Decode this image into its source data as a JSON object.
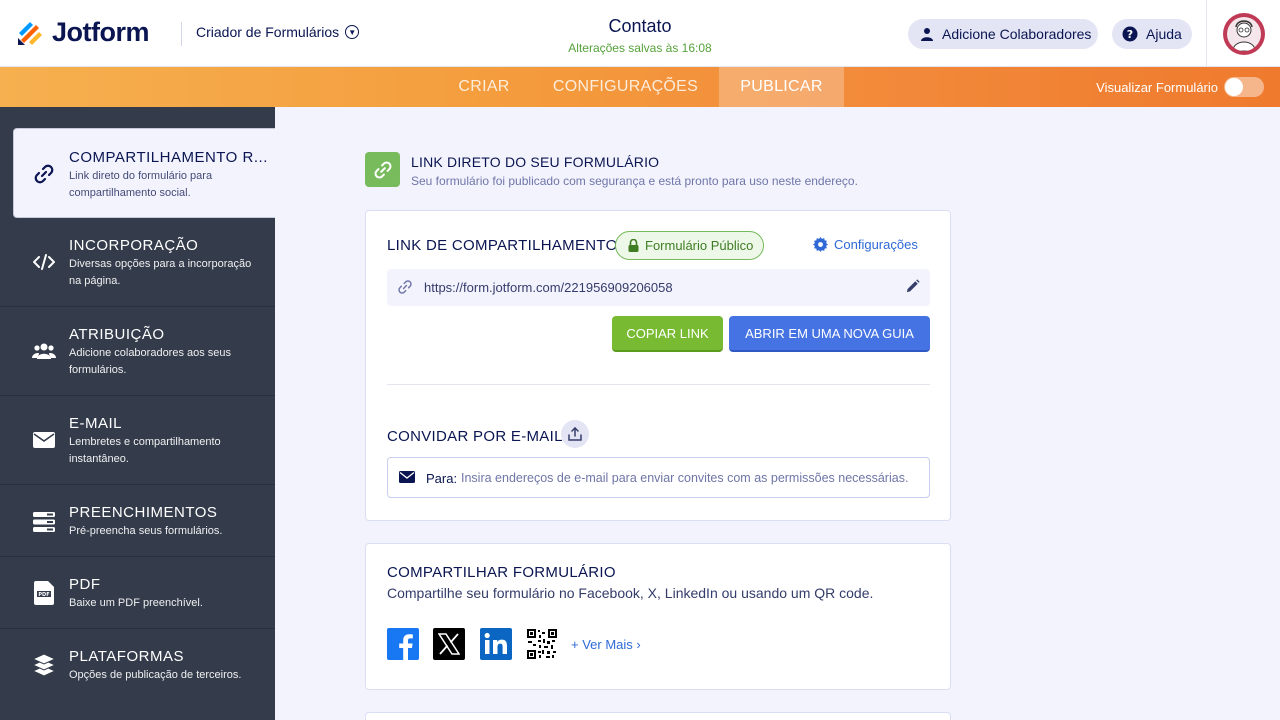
{
  "header": {
    "brand": "Jotform",
    "builder": "Criador de Formulários",
    "form_title": "Contato",
    "saved_status": "Alterações salvas às 16:08",
    "collaborators_label": "Adicione Colaboradores",
    "help_label": "Ajuda"
  },
  "nav": {
    "tabs": [
      {
        "label": "CRIAR"
      },
      {
        "label": "CONFIGURAÇÕES"
      },
      {
        "label": "PUBLICAR",
        "active": true
      }
    ],
    "preview_label": "Visualizar Formulário",
    "preview_on": false
  },
  "sidebar": {
    "items": [
      {
        "title": "COMPARTILHAMENTO R...",
        "desc": "Link direto do formulário para compartilhamento social.",
        "icon": "link-icon",
        "active": true
      },
      {
        "title": "INCORPORAÇÃO",
        "desc": "Diversas opções para a incorporação na página.",
        "icon": "code-icon"
      },
      {
        "title": "ATRIBUIÇÃO",
        "desc": "Adicione colaboradores aos seus formulários.",
        "icon": "users-icon"
      },
      {
        "title": "E-MAIL",
        "desc": "Lembretes e compartilhamento instantâneo.",
        "icon": "envelope-icon"
      },
      {
        "title": "PREENCHIMENTOS",
        "desc": "Pré-preencha seus formulários.",
        "icon": "prefill-icon"
      },
      {
        "title": "PDF",
        "desc": "Baixe um PDF preenchível.",
        "icon": "pdf-icon"
      },
      {
        "title": "PLATAFORMAS",
        "desc": "Opções de publicação de terceiros.",
        "icon": "layers-icon"
      }
    ]
  },
  "direct": {
    "title": "LINK DIRETO DO SEU FORMULÁRIO",
    "subtitle": "Seu formulário foi publicado com segurança e está pronto para uso neste endereço."
  },
  "share_link": {
    "title": "LINK DE COMPARTILHAMENTO",
    "badge": "Formulário Público",
    "settings": "Configurações",
    "url": "https://form.jotform.com/221956909206058",
    "copy_button": "COPIAR LINK",
    "open_button": "ABRIR EM UMA NOVA GUIA"
  },
  "invite": {
    "title": "CONVIDAR POR E-MAIL",
    "to_label": "Para:",
    "placeholder": "Insira endereços de e-mail para enviar convites com as permissões necessárias."
  },
  "share_form": {
    "title": "COMPARTILHAR FORMULÁRIO",
    "subtitle": "Compartilhe seu formulário no Facebook, X, LinkedIn ou usando um QR code.",
    "see_more": "+ Ver Mais ›"
  },
  "colors": {
    "navy": "#0a1551",
    "orange": "#f49c3d",
    "green": "#78bb32",
    "blue": "#4573e3",
    "sidebar": "#343c4b"
  }
}
